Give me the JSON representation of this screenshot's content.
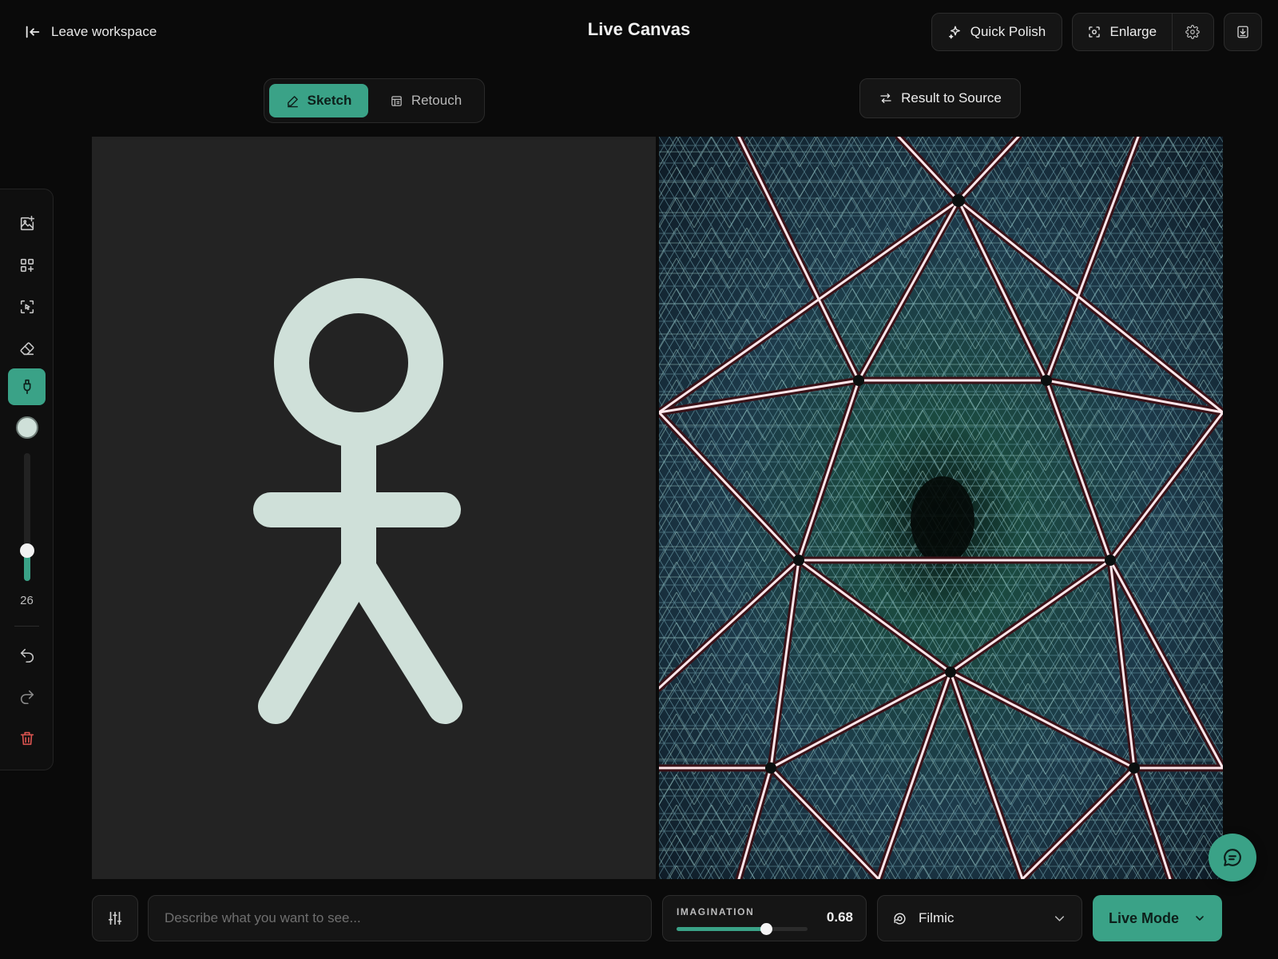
{
  "header": {
    "leave_label": "Leave workspace",
    "title": "Live Canvas",
    "quick_polish_label": "Quick Polish",
    "enlarge_label": "Enlarge"
  },
  "mode_tabs": [
    {
      "label": "Sketch",
      "active": true
    },
    {
      "label": "Retouch",
      "active": false
    }
  ],
  "result_to_source_label": "Result to Source",
  "toolbar": {
    "tools": [
      "add-image-icon",
      "add-element-icon",
      "select-region-icon",
      "eraser-icon",
      "brush-icon"
    ],
    "active_tool": "brush-icon",
    "brush_color": "#cfe0d9",
    "brush_size": "26",
    "brush_size_level": 0.24
  },
  "bottom": {
    "prompt_placeholder": "Describe what you want to see...",
    "prompt_value": "",
    "imagination_label": "IMAGINATION",
    "imagination_value": "0.68",
    "imagination_level": 0.68,
    "style_label": "Filmic",
    "live_mode_label": "Live Mode"
  },
  "colors": {
    "accent": "#3aa287",
    "background": "#0a0a0a",
    "sketch_canvas": "#232323",
    "stroke": "#cfe0d9",
    "danger": "#d9534f"
  }
}
